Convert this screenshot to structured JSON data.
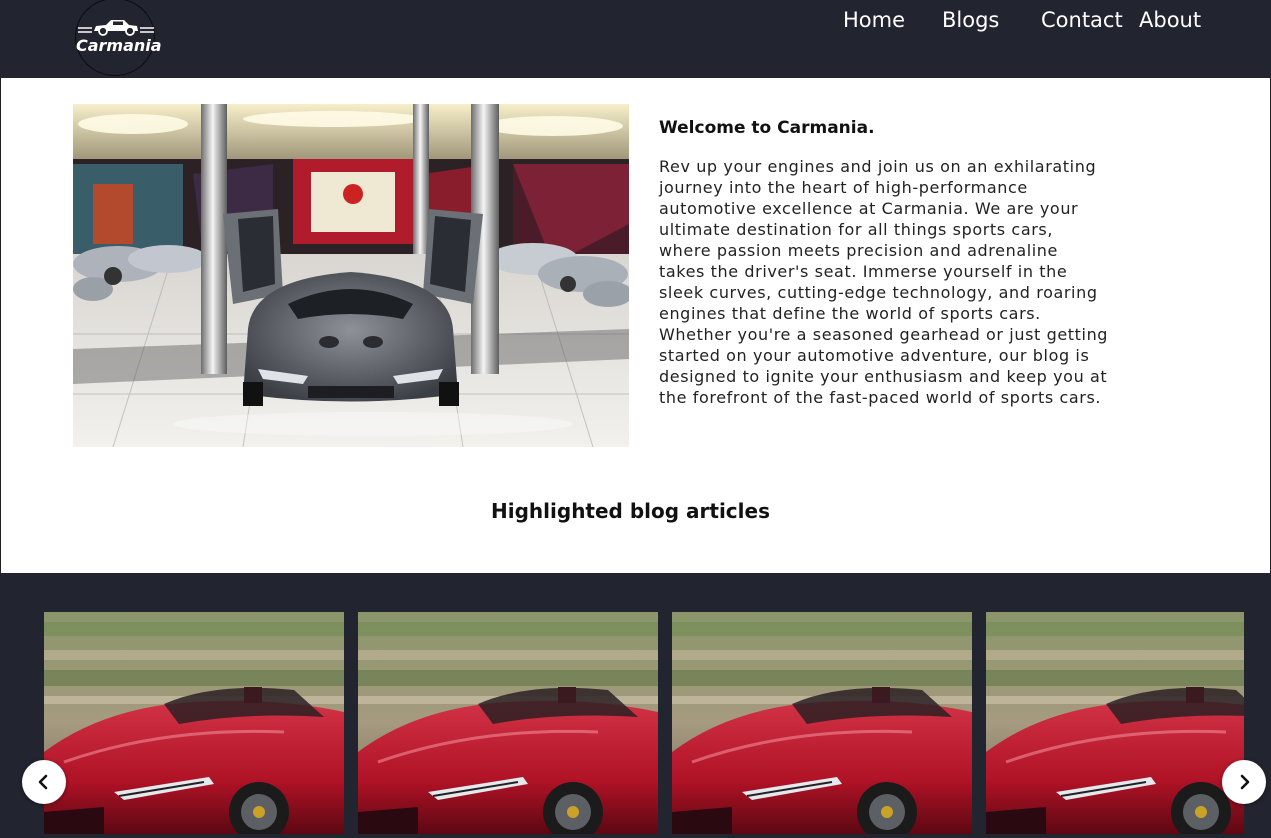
{
  "brand": {
    "logo_text": "Carmania"
  },
  "nav": {
    "home": "Home",
    "blogs": "Blogs",
    "contact": "Contact",
    "about": "About"
  },
  "hero": {
    "title": "Welcome to Carmania.",
    "body": "Rev up your engines and join us on an exhilarating journey into the heart of high-performance automotive excellence at Carmania. We are your ultimate destination for all things sports cars, where passion meets precision and adrenaline takes the driver's seat. Immerse yourself in the sleek curves, cutting-edge technology, and roaring engines that define the world of sports cars. Whether you're a seasoned gearhead or just getting started on your automotive adventure, our blog is designed to ignite your enthusiasm and keep you at the forefront of the fast-paced world of sports cars."
  },
  "highlighted": {
    "title": "Highlighted blog articles"
  },
  "carousel": {
    "prev_icon": "chevron-left-icon",
    "next_icon": "chevron-right-icon",
    "cards": [
      {
        "image": "red-convertible-photo"
      },
      {
        "image": "red-convertible-photo"
      },
      {
        "image": "red-convertible-photo"
      },
      {
        "image": "red-convertible-photo"
      }
    ]
  },
  "colors": {
    "navbar_bg": "#22242f",
    "carousel_bg": "#22242f",
    "car_red": "#b01226"
  }
}
